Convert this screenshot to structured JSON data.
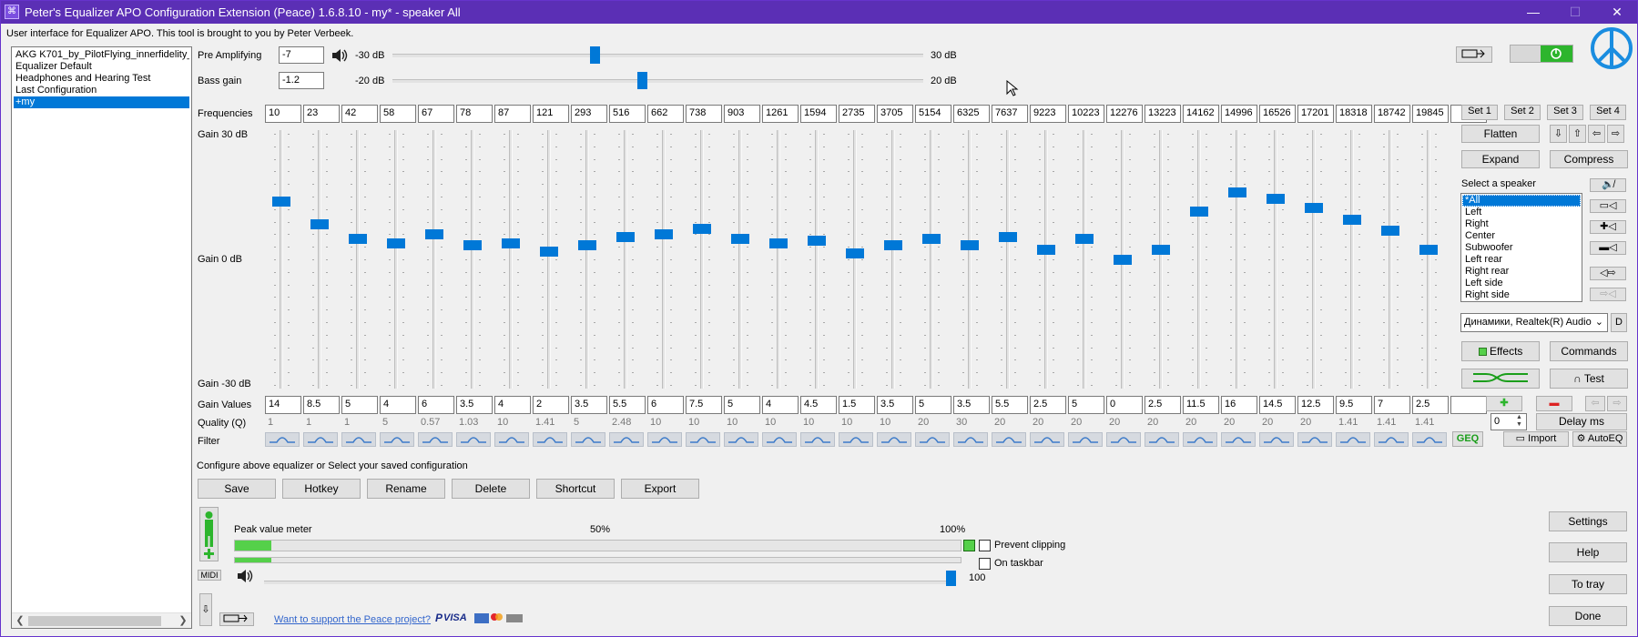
{
  "window": {
    "title": "Peter's Equalizer APO Configuration Extension (Peace) 1.6.8.10 - my* - speaker All",
    "minimize_glyph": "—",
    "maximize_glyph": "☐",
    "close_glyph": "✕"
  },
  "subtitle": "User interface for Equalizer APO. This tool is brought to you by Peter Verbeek.",
  "configs": [
    {
      "label": "AKG K701_by_PilotFlying_innerfidelity_Ac",
      "selected": false
    },
    {
      "label": "Equalizer Default",
      "selected": false
    },
    {
      "label": "Headphones and Hearing Test",
      "selected": false
    },
    {
      "label": "Last Configuration",
      "selected": false
    },
    {
      "label": "+my",
      "selected": true
    }
  ],
  "preamp": {
    "label": "Pre Amplifying",
    "value": "-7",
    "min_label": "-30 dB",
    "max_label": "30 dB",
    "level": 0.38
  },
  "bass": {
    "label": "Bass gain",
    "value": "-1.2",
    "min_label": "-20 dB",
    "max_label": "20 dB",
    "level": 0.47
  },
  "eq": {
    "frequencies_label": "Frequencies",
    "gain_top": "Gain 30 dB",
    "gain_mid": "Gain 0 dB",
    "gain_bottom": "Gain -30 dB",
    "gain_values_label": "Gain Values",
    "quality_label": "Quality (Q)",
    "filter_label": "Filter",
    "gain_min": -30,
    "gain_max": 30,
    "frequencies": [
      "10",
      "23",
      "42",
      "58",
      "67",
      "78",
      "87",
      "121",
      "293",
      "516",
      "662",
      "738",
      "903",
      "1261",
      "1594",
      "2735",
      "3705",
      "5154",
      "6325",
      "7637",
      "9223",
      "10223",
      "12276",
      "13223",
      "14162",
      "14996",
      "16526",
      "17201",
      "18318",
      "18742",
      "19845",
      ""
    ],
    "gains": [
      "14",
      "8.5",
      "5",
      "4",
      "6",
      "3.5",
      "4",
      "2",
      "3.5",
      "5.5",
      "6",
      "7.5",
      "5",
      "4",
      "4.5",
      "1.5",
      "3.5",
      "5",
      "3.5",
      "5.5",
      "2.5",
      "5",
      "0",
      "2.5",
      "11.5",
      "16",
      "14.5",
      "12.5",
      "9.5",
      "7",
      "2.5",
      ""
    ],
    "qualities": [
      "1",
      "1",
      "1",
      "5",
      "0.57",
      "1.03",
      "10",
      "1.41",
      "5",
      "2.48",
      "10",
      "10",
      "10",
      "10",
      "10",
      "10",
      "10",
      "20",
      "30",
      "20",
      "20",
      "20",
      "20",
      "20",
      "20",
      "20",
      "20",
      "20",
      "1.41",
      "1.41",
      "1.41"
    ]
  },
  "sets": [
    "Set 1",
    "Set 2",
    "Set 3",
    "Set 4"
  ],
  "buttons": {
    "flatten": "Flatten",
    "expand": "Expand",
    "compress": "Compress",
    "effects": "Effects",
    "commands": "Commands",
    "test": "Test",
    "import": "Import",
    "autoeq": "AutoEQ",
    "geq": "GEQ",
    "delay": "Delay ms",
    "delay_value": "0",
    "save": "Save",
    "hotkey": "Hotkey",
    "rename": "Rename",
    "delete": "Delete",
    "shortcut": "Shortcut",
    "export": "Export",
    "settings": "Settings",
    "help": "Help",
    "to_tray": "To tray",
    "done": "Done",
    "device_d": "D"
  },
  "speaker": {
    "select_label": "Select a speaker",
    "items": [
      "*All",
      "Left",
      "Right",
      "Center",
      "Subwoofer",
      "Left rear",
      "Right rear",
      "Left side",
      "Right side"
    ],
    "selected": 0,
    "device": "Динамики, Realtek(R) Audio"
  },
  "config_hint": "Configure above equalizer or Select your saved configuration",
  "meter": {
    "label": "Peak value meter",
    "mid_label": "50%",
    "max_label": "100%",
    "level_top": 0.05,
    "level_bottom": 0.05,
    "volume_label": "100",
    "volume_level": 1.0
  },
  "prevent_clipping": "Prevent clipping",
  "on_taskbar": "On taskbar",
  "midi": "MIDI",
  "support_link": "Want to support the Peace project?",
  "payment_marks": "VISA",
  "colors": {
    "accent": "#0078d7",
    "title_bar": "#5b2fb5",
    "meter_green": "#55d04a",
    "geq_green": "#1a9e1a"
  }
}
